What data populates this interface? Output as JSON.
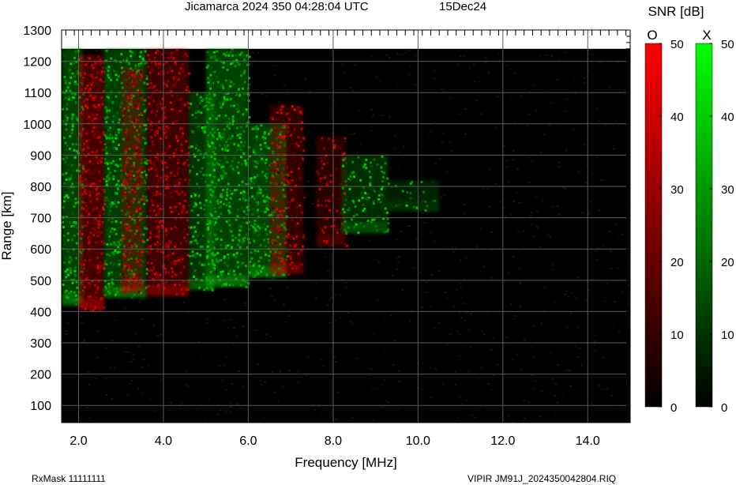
{
  "header": {
    "title": "Jicamarca 2024 350 04:28:04 UTC",
    "date": "15Dec24"
  },
  "footer": {
    "rxmask": "RxMask 11111111",
    "filename": "VIPIR  JM91J_2024350042804.RIQ"
  },
  "colors": {
    "o_mode": "#ff0000",
    "x_mode": "#00ff00",
    "background": "#000000",
    "grid": "#5a5a5a"
  },
  "chart_data": {
    "type": "heatmap",
    "title": "Jicamarca 2024 350 04:28:04 UTC",
    "xlabel": "Frequency [MHz]",
    "ylabel": "Range [km]",
    "xlim": [
      1.6,
      15.0
    ],
    "ylim": [
      45,
      1300
    ],
    "x_ticks": [
      2.0,
      4.0,
      6.0,
      8.0,
      10.0,
      12.0,
      14.0
    ],
    "x_tick_labels": [
      "2.0",
      "4.0",
      "6.0",
      "8.0",
      "10.0",
      "12.0",
      "14.0"
    ],
    "y_ticks": [
      100,
      200,
      300,
      400,
      500,
      600,
      700,
      800,
      900,
      1000,
      1100,
      1200,
      1300
    ],
    "grid": true,
    "data_extent": {
      "range_max_km": 1240
    },
    "colorbar": {
      "label": "SNR [dB]",
      "range": [
        0,
        50
      ],
      "ticks": [
        0,
        10,
        20,
        30,
        40,
        50
      ],
      "channels": [
        {
          "name": "O",
          "color": "#ff0000"
        },
        {
          "name": "X",
          "color": "#00ff00"
        }
      ]
    },
    "echo_traces": [
      {
        "mode": "X",
        "f_start_mhz": 1.6,
        "f_end_mhz": 2.1,
        "range_min_km": 420,
        "range_max_km": 1240,
        "snr_db": 38
      },
      {
        "mode": "O",
        "f_start_mhz": 2.0,
        "f_end_mhz": 2.6,
        "range_min_km": 405,
        "range_max_km": 1220,
        "snr_db": 44
      },
      {
        "mode": "X",
        "f_start_mhz": 2.6,
        "f_end_mhz": 3.6,
        "range_min_km": 445,
        "range_max_km": 1240,
        "snr_db": 36
      },
      {
        "mode": "O",
        "f_start_mhz": 3.0,
        "f_end_mhz": 3.5,
        "range_min_km": 460,
        "range_max_km": 1180,
        "snr_db": 32
      },
      {
        "mode": "O",
        "f_start_mhz": 3.6,
        "f_end_mhz": 4.6,
        "range_min_km": 450,
        "range_max_km": 1240,
        "snr_db": 34
      },
      {
        "mode": "X",
        "f_start_mhz": 4.6,
        "f_end_mhz": 5.2,
        "range_min_km": 470,
        "range_max_km": 1100,
        "snr_db": 28
      },
      {
        "mode": "X",
        "f_start_mhz": 5.0,
        "f_end_mhz": 6.0,
        "range_min_km": 480,
        "range_max_km": 1240,
        "snr_db": 40
      },
      {
        "mode": "X",
        "f_start_mhz": 6.0,
        "f_end_mhz": 6.9,
        "range_min_km": 510,
        "range_max_km": 1000,
        "snr_db": 40
      },
      {
        "mode": "O",
        "f_start_mhz": 6.5,
        "f_end_mhz": 7.3,
        "range_min_km": 520,
        "range_max_km": 1060,
        "snr_db": 26
      },
      {
        "mode": "O",
        "f_start_mhz": 7.6,
        "f_end_mhz": 8.3,
        "range_min_km": 610,
        "range_max_km": 960,
        "snr_db": 18
      },
      {
        "mode": "X",
        "f_start_mhz": 8.2,
        "f_end_mhz": 9.3,
        "range_min_km": 650,
        "range_max_km": 900,
        "snr_db": 22
      },
      {
        "mode": "X",
        "f_start_mhz": 9.3,
        "f_end_mhz": 10.5,
        "range_min_km": 720,
        "range_max_km": 820,
        "snr_db": 10
      }
    ]
  }
}
